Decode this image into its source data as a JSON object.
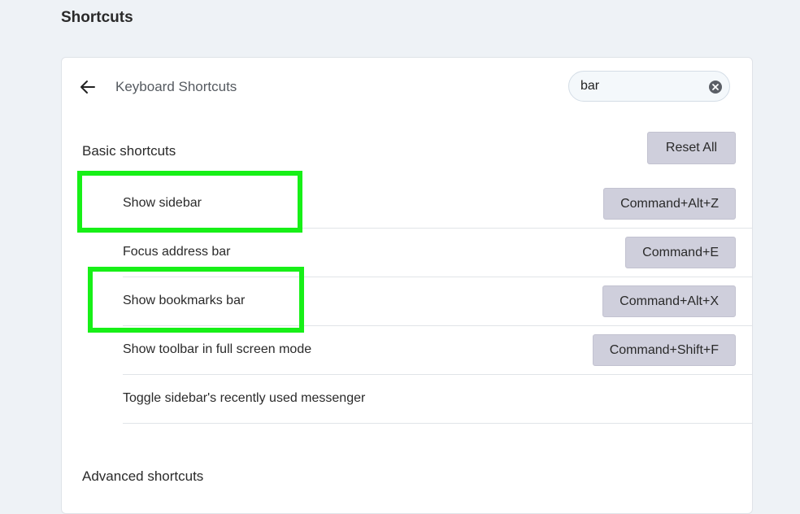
{
  "page": {
    "title": "Shortcuts"
  },
  "header": {
    "back_icon": "arrow-left-icon",
    "title": "Keyboard Shortcuts",
    "search": {
      "value": "bar",
      "clear_icon": "clear-circle-x-icon"
    }
  },
  "basic": {
    "title": "Basic shortcuts",
    "reset_label": "Reset All",
    "rows": [
      {
        "label": "Show sidebar",
        "key": "Command+Alt+Z"
      },
      {
        "label": "Focus address bar",
        "key": "Command+E"
      },
      {
        "label": "Show bookmarks bar",
        "key": "Command+Alt+X"
      },
      {
        "label": "Show toolbar in full screen mode",
        "key": "Command+Shift+F"
      },
      {
        "label": "Toggle sidebar's recently used messenger",
        "key": ""
      }
    ]
  },
  "advanced": {
    "title": "Advanced shortcuts"
  },
  "colors": {
    "highlight": "#17f017",
    "key_button_bg": "#cfcfdc",
    "background": "#eef2f6"
  }
}
